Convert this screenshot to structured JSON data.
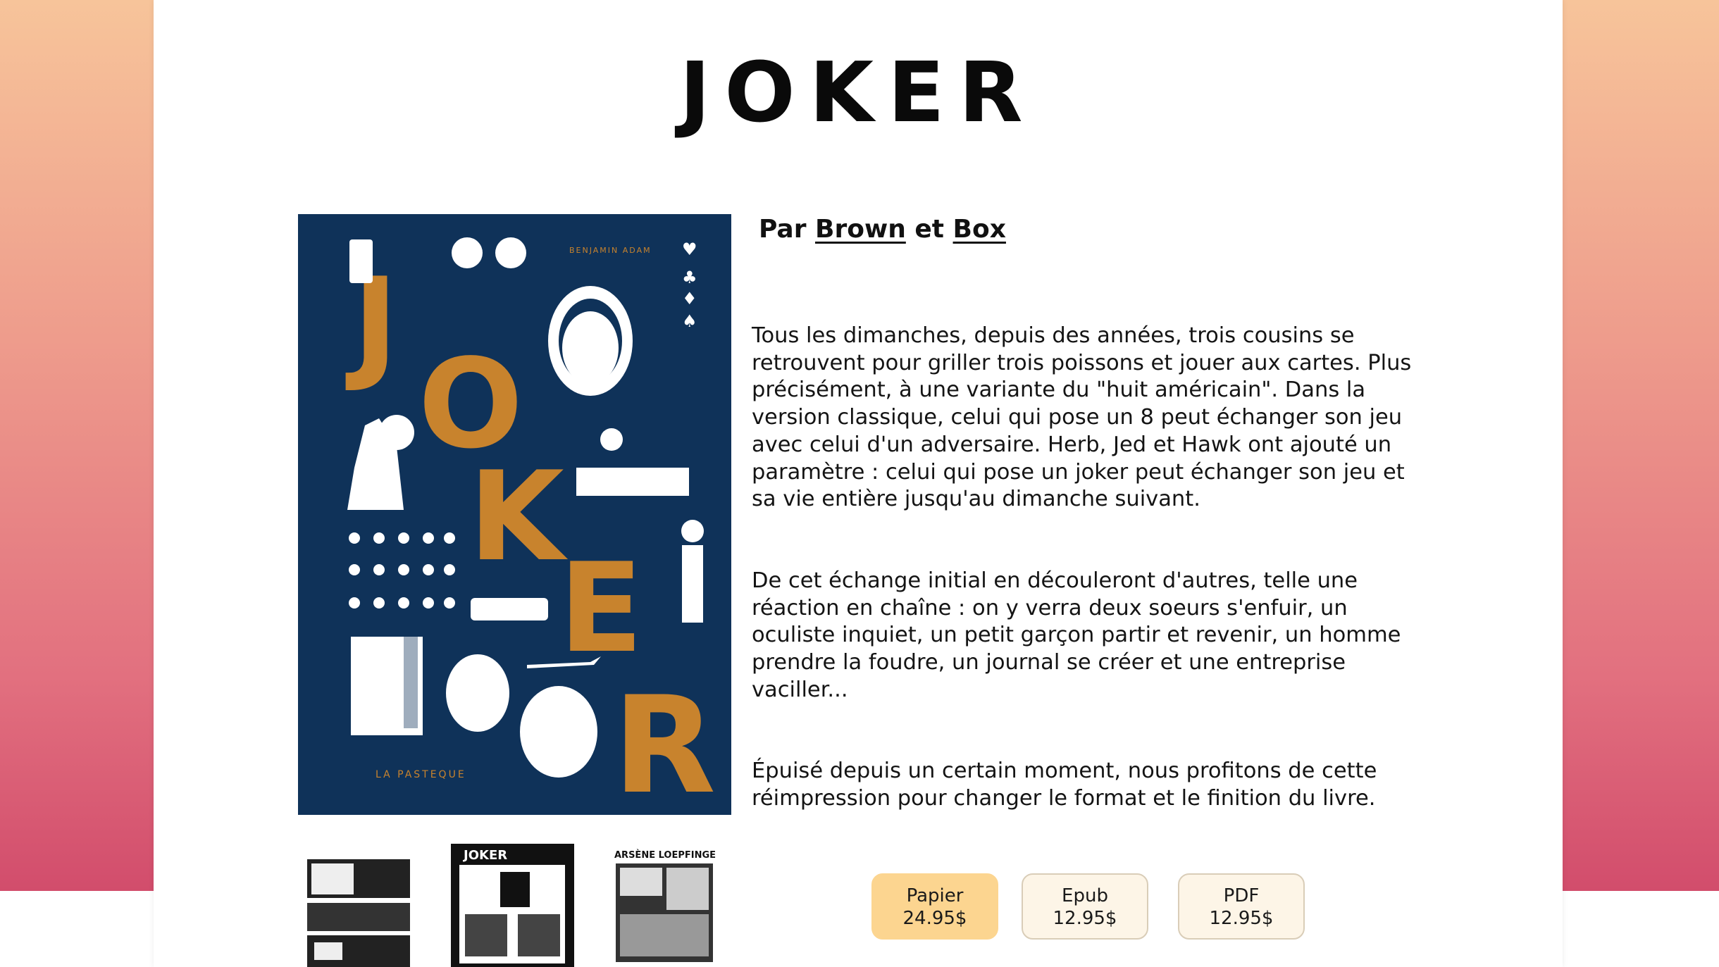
{
  "page": {
    "title": "JOKER"
  },
  "byline": {
    "prefix": "Par",
    "connector": "et",
    "author1": "Brown",
    "author2": "Box"
  },
  "cover": {
    "letters": [
      "J",
      "O",
      "K",
      "E",
      "R"
    ],
    "author": "BENJAMIN ADAM",
    "publisher": "LA PASTEQUE"
  },
  "description": [
    "Tous les dimanches, depuis des années, trois cousins se retrouvent pour griller trois poissons et jouer aux cartes. Plus précisément, à une variante du \"huit américain\". Dans la version classique, celui qui pose un 8 peut échanger son jeu avec celui d'un adversaire. Herb, Jed et Hawk ont ajouté un paramètre : celui qui pose un joker peut échanger son jeu et sa vie entière jusqu'au dimanche suivant.",
    "De cet échange initial en découleront d'autres, telle une réaction en chaîne : on y verra deux soeurs s'enfuir, un oculiste inquiet, un petit garçon partir et revenir, un homme prendre la foudre, un journal se créer et une entreprise vaciller...",
    "Épuisé depuis un certain moment, nous profitons de cette réimpression pour changer le format et le finition du livre."
  ],
  "thumbnails": {
    "t2_title": "JOKER",
    "t3_title": "ARSÈNE LOEPFINGER"
  },
  "formats": [
    {
      "label": "Papier",
      "price": "24.95$",
      "selected": true
    },
    {
      "label": "Epub",
      "price": "12.95$",
      "selected": false
    },
    {
      "label": "PDF",
      "price": "12.95$",
      "selected": false
    }
  ],
  "colors": {
    "cover_bg": "#0f3259",
    "cover_accent": "#c8832d",
    "selected_format": "#fcd590"
  }
}
